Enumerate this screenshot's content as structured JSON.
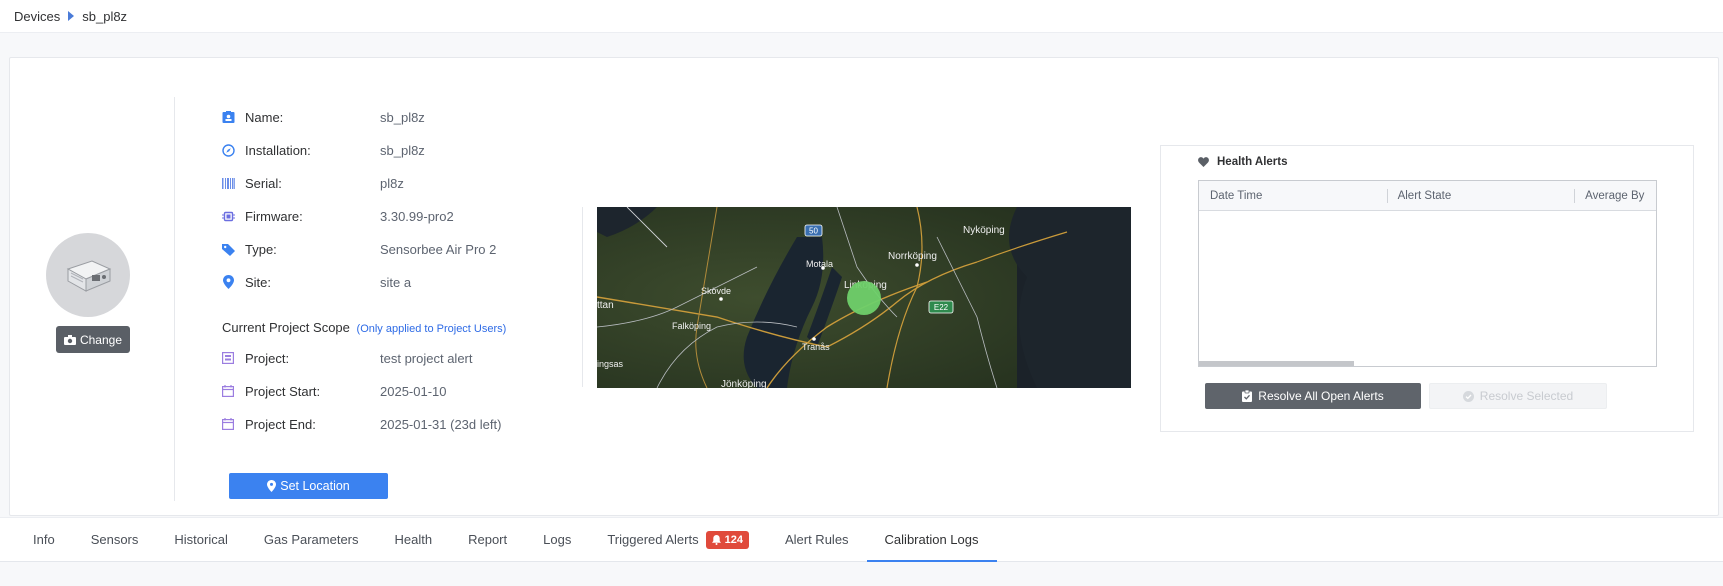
{
  "breadcrumb": {
    "root": "Devices",
    "current": "sb_pl8z"
  },
  "device": {
    "change_label": "Change",
    "fields": {
      "name": {
        "label": "Name:",
        "value": "sb_pl8z"
      },
      "installation": {
        "label": "Installation:",
        "value": "sb_pl8z"
      },
      "serial": {
        "label": "Serial:",
        "value": "pl8z"
      },
      "firmware": {
        "label": "Firmware:",
        "value": "3.30.99-pro2"
      },
      "type": {
        "label": "Type:",
        "value": "Sensorbee Air Pro 2"
      },
      "site": {
        "label": "Site:",
        "value": "site a"
      }
    },
    "scope": {
      "title": "Current Project Scope",
      "note": "(Only applied to Project Users)",
      "project": {
        "label": "Project:",
        "value": "test project alert"
      },
      "start": {
        "label": "Project Start:",
        "value": "2025-01-10"
      },
      "end": {
        "label": "Project End:",
        "value": "2025-01-31 (23d left)"
      }
    },
    "set_location_label": "Set Location"
  },
  "map": {
    "labels": [
      "Nyköping",
      "Norrköping",
      "Motala",
      "Linköping",
      "Skövde",
      "Falköping",
      "Tranås",
      "Jönköping",
      "ttan",
      "ingsas"
    ],
    "shields": [
      "50",
      "E22"
    ]
  },
  "health_alerts": {
    "title": "Health Alerts",
    "columns": [
      "Date Time",
      "Alert State",
      "Average By"
    ],
    "rows": [],
    "resolve_all_label": "Resolve All Open Alerts",
    "resolve_selected_label": "Resolve Selected"
  },
  "tabs": [
    {
      "label": "Info"
    },
    {
      "label": "Sensors"
    },
    {
      "label": "Historical"
    },
    {
      "label": "Gas Parameters"
    },
    {
      "label": "Health"
    },
    {
      "label": "Report"
    },
    {
      "label": "Logs"
    },
    {
      "label": "Triggered Alerts",
      "badge": "124"
    },
    {
      "label": "Alert Rules"
    },
    {
      "label": "Calibration Logs",
      "active": true
    }
  ],
  "colors": {
    "primary": "#3b82f0",
    "badge": "#e04a3b",
    "marker": "#6fd06a"
  }
}
